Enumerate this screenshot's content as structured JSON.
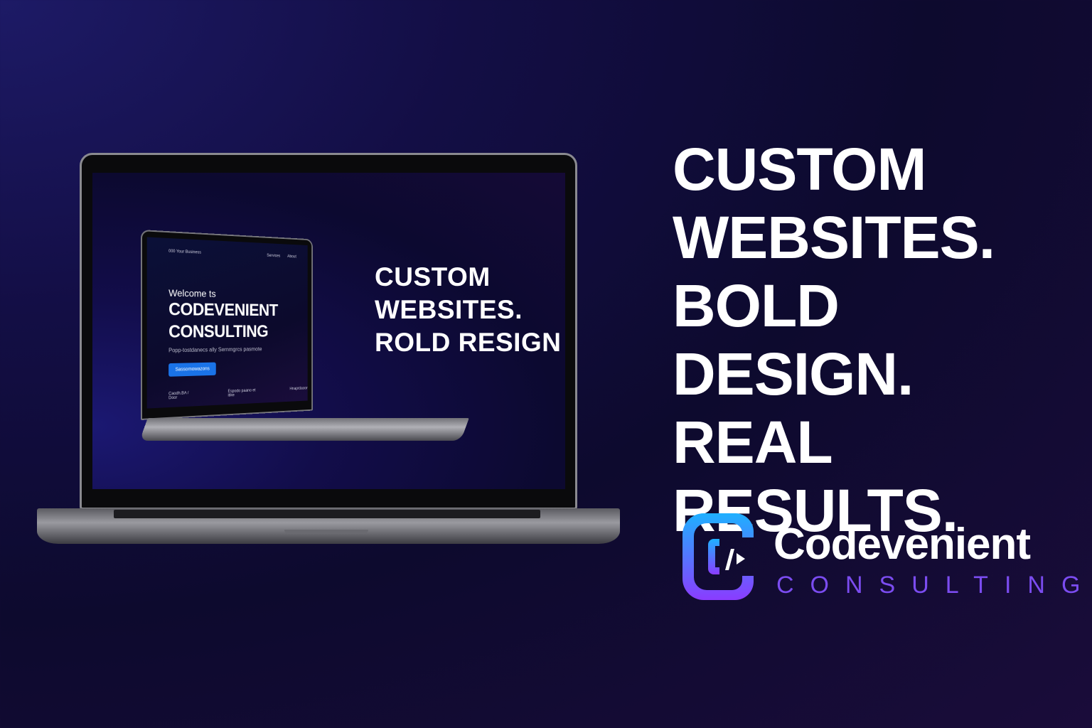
{
  "headline": {
    "line1": "CUSTOM",
    "line2": "WEBSITES.",
    "line3": "BOLD DESIGN.",
    "line4": "REAL RESULTS."
  },
  "brand": {
    "name": "Codevenient",
    "tagline": "CONSULTING",
    "logo_glyph": "</>",
    "colors": {
      "gradient_top": "#1fb0ff",
      "gradient_bottom": "#8a3cff",
      "tagline": "#7b4cf0"
    }
  },
  "laptop_screen": {
    "headline": {
      "line1": "CUSTOM",
      "line2": "WEBSITES.",
      "line3": "ROLD RESIGN"
    },
    "inner_site": {
      "nav_logo": "000 Your Business",
      "nav_links": [
        "Services",
        "About"
      ],
      "welcome": "Welcome ts",
      "title_line1": "CODEVENIENT",
      "title_line2": "CONSULTING",
      "subtitle": "Popp-tostdanecs ally Sernmgrcs pasmote",
      "cta": "Sassomowazons",
      "footer": [
        "Caodh.BA / Door",
        "Espodo paano et itike",
        "Hnaprdaoor"
      ],
      "cta_color": "#1a73e8"
    }
  }
}
